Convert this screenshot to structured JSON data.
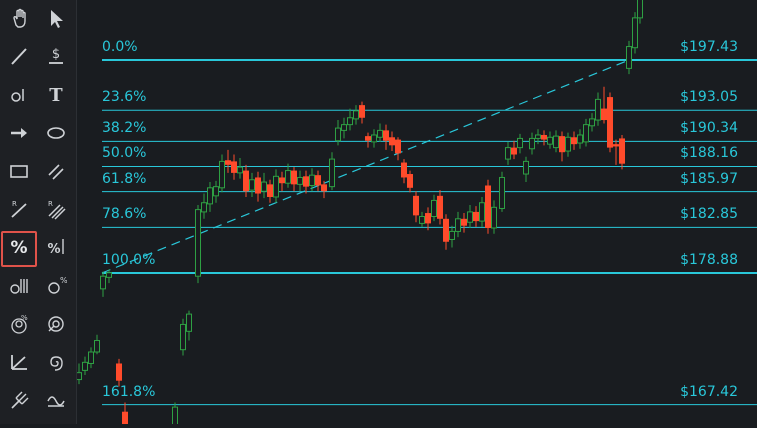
{
  "toolbar": {
    "active_tool": "fibonacci-retracement-tool",
    "tools": [
      {
        "name": "hand-tool",
        "icon": "hand-icon"
      },
      {
        "name": "cursor-tool",
        "icon": "cursor-arrow-icon"
      },
      {
        "name": "trend-line-tool",
        "icon": "line-icon"
      },
      {
        "name": "price-label-tool",
        "icon": "dollar-label-icon"
      },
      {
        "name": "horizontal-ray-tool",
        "icon": "horizontal-ray-icon"
      },
      {
        "name": "text-tool",
        "icon": "text-icon"
      },
      {
        "name": "arrow-tool",
        "icon": "arrow-right-icon"
      },
      {
        "name": "ellipse-tool",
        "icon": "ellipse-icon"
      },
      {
        "name": "rectangle-tool",
        "icon": "rectangle-icon"
      },
      {
        "name": "parallel-lines-tool",
        "icon": "parallel-lines-icon"
      },
      {
        "name": "regression-line-tool",
        "icon": "regression-line-icon"
      },
      {
        "name": "regression-channel-tool",
        "icon": "regression-channel-icon"
      },
      {
        "name": "fibonacci-retracement-tool",
        "icon": "percent-icon"
      },
      {
        "name": "fibonacci-extension-tool",
        "icon": "percent-extension-icon"
      },
      {
        "name": "fibonacci-time-zones-tool",
        "icon": "fib-time-zones-icon"
      },
      {
        "name": "fibonacci-fan-tool",
        "icon": "fib-fan-icon"
      },
      {
        "name": "fibonacci-arcs-tool",
        "icon": "fib-arcs-icon"
      },
      {
        "name": "fibonacci-circles-tool",
        "icon": "fib-circles-icon"
      },
      {
        "name": "gann-fan-tool",
        "icon": "angle-icon"
      },
      {
        "name": "fibonacci-spiral-tool",
        "icon": "spiral-icon"
      },
      {
        "name": "pitchfork-tool",
        "icon": "pitchfork-icon"
      },
      {
        "name": "sine-line-tool",
        "icon": "sine-wave-icon"
      }
    ]
  },
  "colors": {
    "background": "#191c20",
    "toolbar_bg": "#1e2024",
    "fib_line": "#29c7d9",
    "candle_up": "#2ea043",
    "candle_down": "#ff4b2b",
    "active_border": "#e0534a"
  },
  "fibonacci": {
    "levels": [
      {
        "ratio": "0.0%",
        "price": "$197.43"
      },
      {
        "ratio": "23.6%",
        "price": "$193.05"
      },
      {
        "ratio": "38.2%",
        "price": "$190.34"
      },
      {
        "ratio": "50.0%",
        "price": "$188.16"
      },
      {
        "ratio": "61.8%",
        "price": "$185.97"
      },
      {
        "ratio": "78.6%",
        "price": "$182.85"
      },
      {
        "ratio": "100.0%",
        "price": "$178.88"
      },
      {
        "ratio": "161.8%",
        "price": "$167.42"
      }
    ]
  }
}
